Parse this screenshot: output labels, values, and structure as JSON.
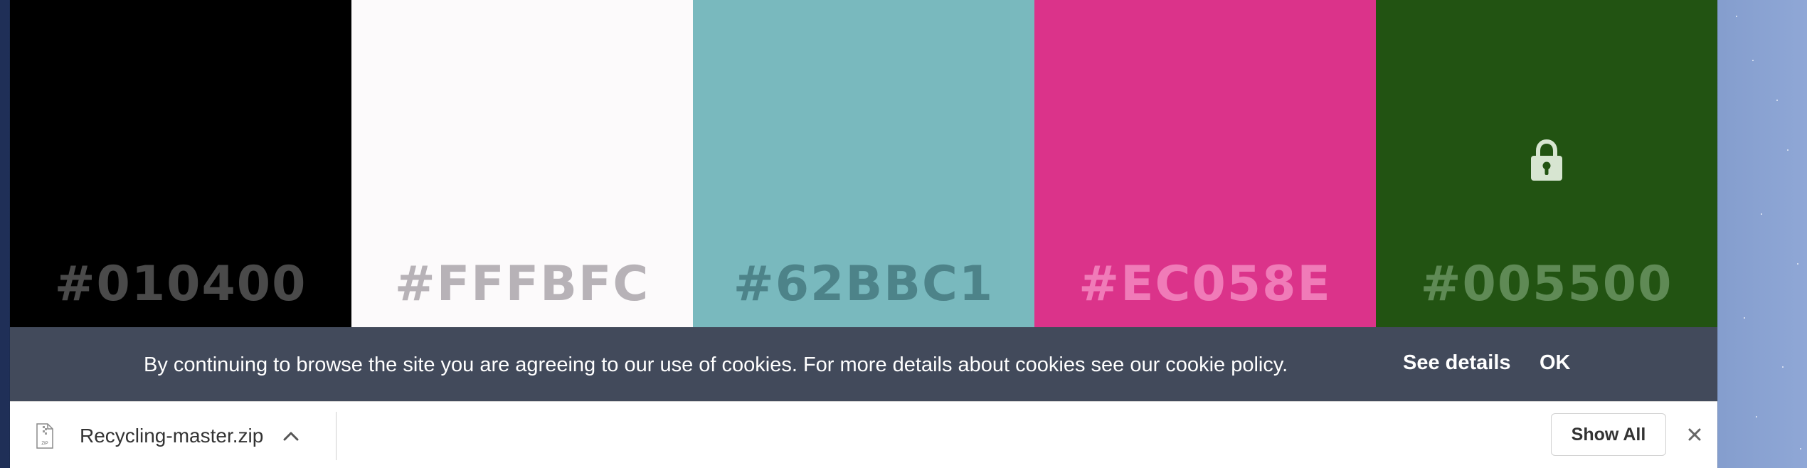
{
  "swatches": [
    {
      "hex": "#010400",
      "background": "#000000",
      "text_color": "#4a4a4a"
    },
    {
      "hex": "#FFFBFC",
      "background": "#fcfafb",
      "text_color": "#b7b2b7"
    },
    {
      "hex": "#62BBC1",
      "background": "#79b9be",
      "text_color": "#4d8389"
    },
    {
      "hex": "#EC058E",
      "background": "#db338a",
      "text_color": "#f07bb8"
    },
    {
      "hex": "#005500",
      "background": "#225312",
      "text_color": "#5f8a55",
      "locked": true
    }
  ],
  "cookie_banner": {
    "text": "By continuing to browse the site you are agreeing to our use of cookies. For more details about cookies see our cookie policy.",
    "see_details_label": "See details",
    "ok_label": "OK"
  },
  "download_bar": {
    "file_name": "Recycling-master.zip",
    "file_type_label": "ZIP",
    "show_all_label": "Show All"
  },
  "icons": {
    "lock": "lock-icon",
    "file": "zip-file-icon",
    "chevron": "chevron-up-icon",
    "close": "close-icon"
  }
}
